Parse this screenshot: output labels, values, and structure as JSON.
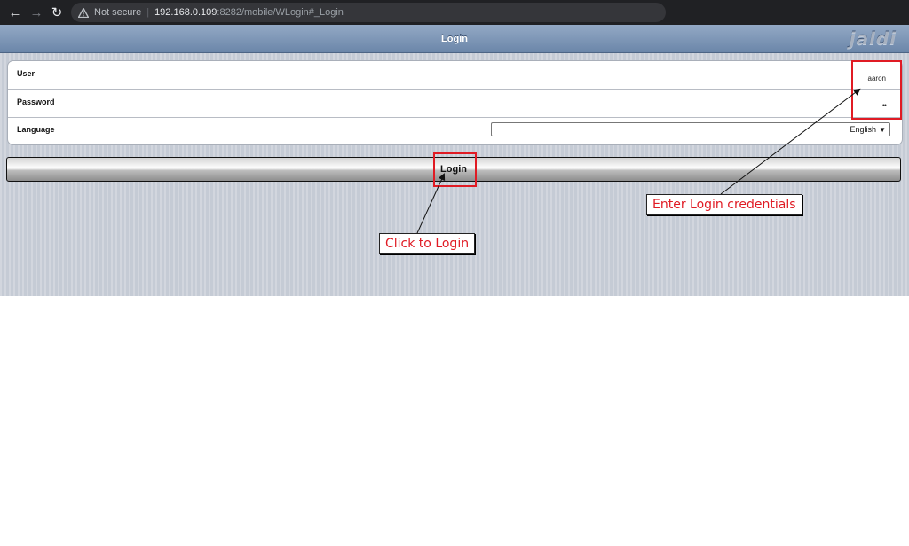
{
  "browser": {
    "security_text": "Not secure",
    "url_host": "192.168.0.109",
    "url_rest": ":8282/mobile/WLogin#_Login"
  },
  "app": {
    "title": "Login",
    "logo": "jaldi",
    "fields": {
      "user_label": "User",
      "user_value": "aaron",
      "password_label": "Password",
      "password_value": "••",
      "language_label": "Language",
      "language_selected": "English"
    },
    "login_button": "Login"
  },
  "annotations": {
    "credentials": "Enter Login credentials",
    "click": "Click to Login"
  },
  "colors": {
    "annotation_red": "#e01b24",
    "header_blue": "#7c95b6"
  }
}
